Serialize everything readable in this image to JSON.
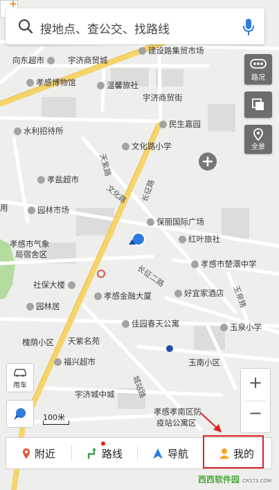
{
  "search": {
    "placeholder": "搜地点、查公交、找路线"
  },
  "side_buttons": {
    "traffic": "路况",
    "panorama": "全景"
  },
  "pois": [
    "向东超市",
    "宇济商贸城",
    "建设路集贸市场",
    "孝感博物馆",
    "温馨旅社",
    "宇济商贸街",
    "民生嘉园",
    "水利招待所",
    "文化路小学",
    "孝盐超市",
    "园林市场",
    "保丽国际广场",
    "红叶旅社",
    "孝感市气象",
    "局宿舍区",
    "孝感市楚澴中学",
    "社保大楼",
    "好宜家酒店",
    "园林居",
    "孝感金融大厦",
    "佳园春天公寓",
    "玉泉小学",
    "槐荫小区",
    "天紫名苑",
    "福兴超市",
    "玉南小区",
    "宇济城中城",
    "孝感孝南区防",
    "疫站公寓区",
    "用"
  ],
  "roads": [
    "长征路",
    "文化路",
    "长征二路",
    "天紫路",
    "玉泉路",
    "城站路"
  ],
  "left_buttons": {
    "car": "用车"
  },
  "scale": "100米",
  "bottom_tabs": [
    {
      "label": "附近",
      "icon": "pin-icon"
    },
    {
      "label": "路线",
      "icon": "route-icon"
    },
    {
      "label": "导航",
      "icon": "navigation-arrow-icon"
    },
    {
      "label": "我的",
      "icon": "person-icon"
    }
  ],
  "watermark": {
    "brand": "西西软件园",
    "url": "CR173.COM"
  },
  "colors": {
    "road_major": "#f5d46a",
    "road": "#ffffff",
    "accent": "#2d7be0",
    "highlight": "#e02020"
  }
}
